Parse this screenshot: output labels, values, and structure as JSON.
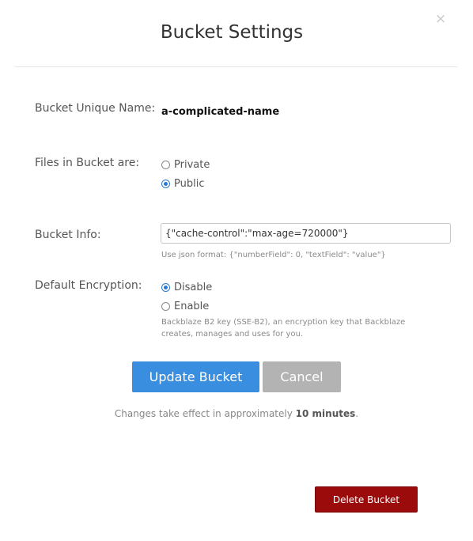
{
  "modal": {
    "title": "Bucket Settings",
    "close_icon": "×"
  },
  "bucket_name": {
    "label": "Bucket Unique Name:",
    "value": "a-complicated-name"
  },
  "privacy": {
    "label": "Files in Bucket are:",
    "options": [
      {
        "label": "Private",
        "selected": false
      },
      {
        "label": "Public",
        "selected": true
      }
    ]
  },
  "bucket_info": {
    "label": "Bucket Info:",
    "value": "{\"cache-control\":\"max-age=720000\"}",
    "hint": "Use json format: {\"numberField\": 0, \"textField\": \"value\"}"
  },
  "encryption": {
    "label": "Default Encryption:",
    "options": [
      {
        "label": "Disable",
        "selected": true
      },
      {
        "label": "Enable",
        "selected": false
      }
    ],
    "hint_line1": "Backblaze B2 key (SSE-B2), an encryption key that Backblaze",
    "hint_line2": "creates, manages and uses for you."
  },
  "buttons": {
    "update": "Update Bucket",
    "cancel": "Cancel",
    "delete": "Delete Bucket"
  },
  "note": {
    "prefix": "Changes take effect in approximately ",
    "emphasis": "10 minutes",
    "suffix": "."
  },
  "colors": {
    "primary": "#3a8ee0",
    "secondary": "#b3b3b3",
    "danger": "#9b0b0b",
    "radio_selected": "#2a7ad3"
  }
}
